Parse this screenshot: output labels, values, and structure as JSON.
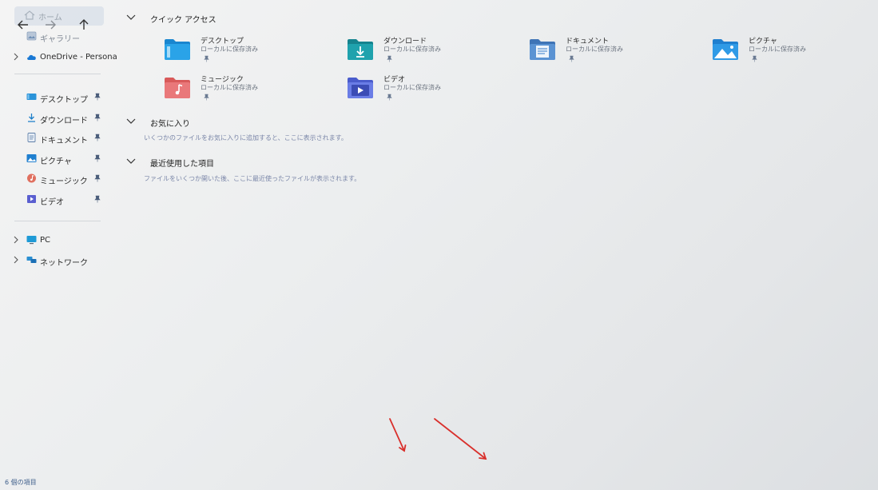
{
  "sidebar": {
    "home_label": "ホーム",
    "items": [
      {
        "label": "ギャラリー",
        "icon": "gallery-icon",
        "pinned": false,
        "expandable": false
      },
      {
        "label": "OneDrive - Persona",
        "icon": "onedrive-icon",
        "pinned": false,
        "expandable": true
      },
      {
        "label": "デスクトップ",
        "icon": "desktop-icon",
        "pinned": true,
        "expandable": false
      },
      {
        "label": "ダウンロード",
        "icon": "download-icon",
        "pinned": true,
        "expandable": false
      },
      {
        "label": "ドキュメント",
        "icon": "document-icon",
        "pinned": true,
        "expandable": false
      },
      {
        "label": "ピクチャ",
        "icon": "pictures-icon",
        "pinned": true,
        "expandable": false
      },
      {
        "label": "ミュージック",
        "icon": "music-icon",
        "pinned": true,
        "expandable": false
      },
      {
        "label": "ビデオ",
        "icon": "video-icon",
        "pinned": true,
        "expandable": false
      },
      {
        "label": "PC",
        "icon": "pc-icon",
        "pinned": false,
        "expandable": true
      },
      {
        "label": "ネットワーク",
        "icon": "network-icon",
        "pinned": false,
        "expandable": true
      }
    ]
  },
  "quick_access": {
    "title": "クイック アクセス",
    "tiles": [
      {
        "name": "デスクトップ",
        "sub": "ローカルに保存済み",
        "icon": "desktop-folder-icon",
        "color": "#1e8fd6"
      },
      {
        "name": "ダウンロード",
        "sub": "ローカルに保存済み",
        "icon": "download-folder-icon",
        "color": "#1b8f9a"
      },
      {
        "name": "ドキュメント",
        "sub": "ローカルに保存済み",
        "icon": "document-folder-icon",
        "color": "#4f86c6"
      },
      {
        "name": "ピクチャ",
        "sub": "ローカルに保存済み",
        "icon": "pictures-folder-icon",
        "color": "#2a8fd8"
      },
      {
        "name": "ミュージック",
        "sub": "ローカルに保存済み",
        "icon": "music-folder-icon",
        "color": "#e06a6a"
      },
      {
        "name": "ビデオ",
        "sub": "ローカルに保存済み",
        "icon": "video-folder-icon",
        "color": "#5a6fd6"
      }
    ]
  },
  "favorites": {
    "title": "お気に入り",
    "desc": "いくつかのファイルをお気に入りに追加すると、ここに表示されます。"
  },
  "recent": {
    "title": "最近使用した項目",
    "desc": "ファイルをいくつか開いた後、ここに最近使ったファイルが表示されます。"
  },
  "status_bar": {
    "count": "6 個の項目"
  },
  "colors": {
    "accent": "#0067c0",
    "arrow": "#d9302c"
  }
}
